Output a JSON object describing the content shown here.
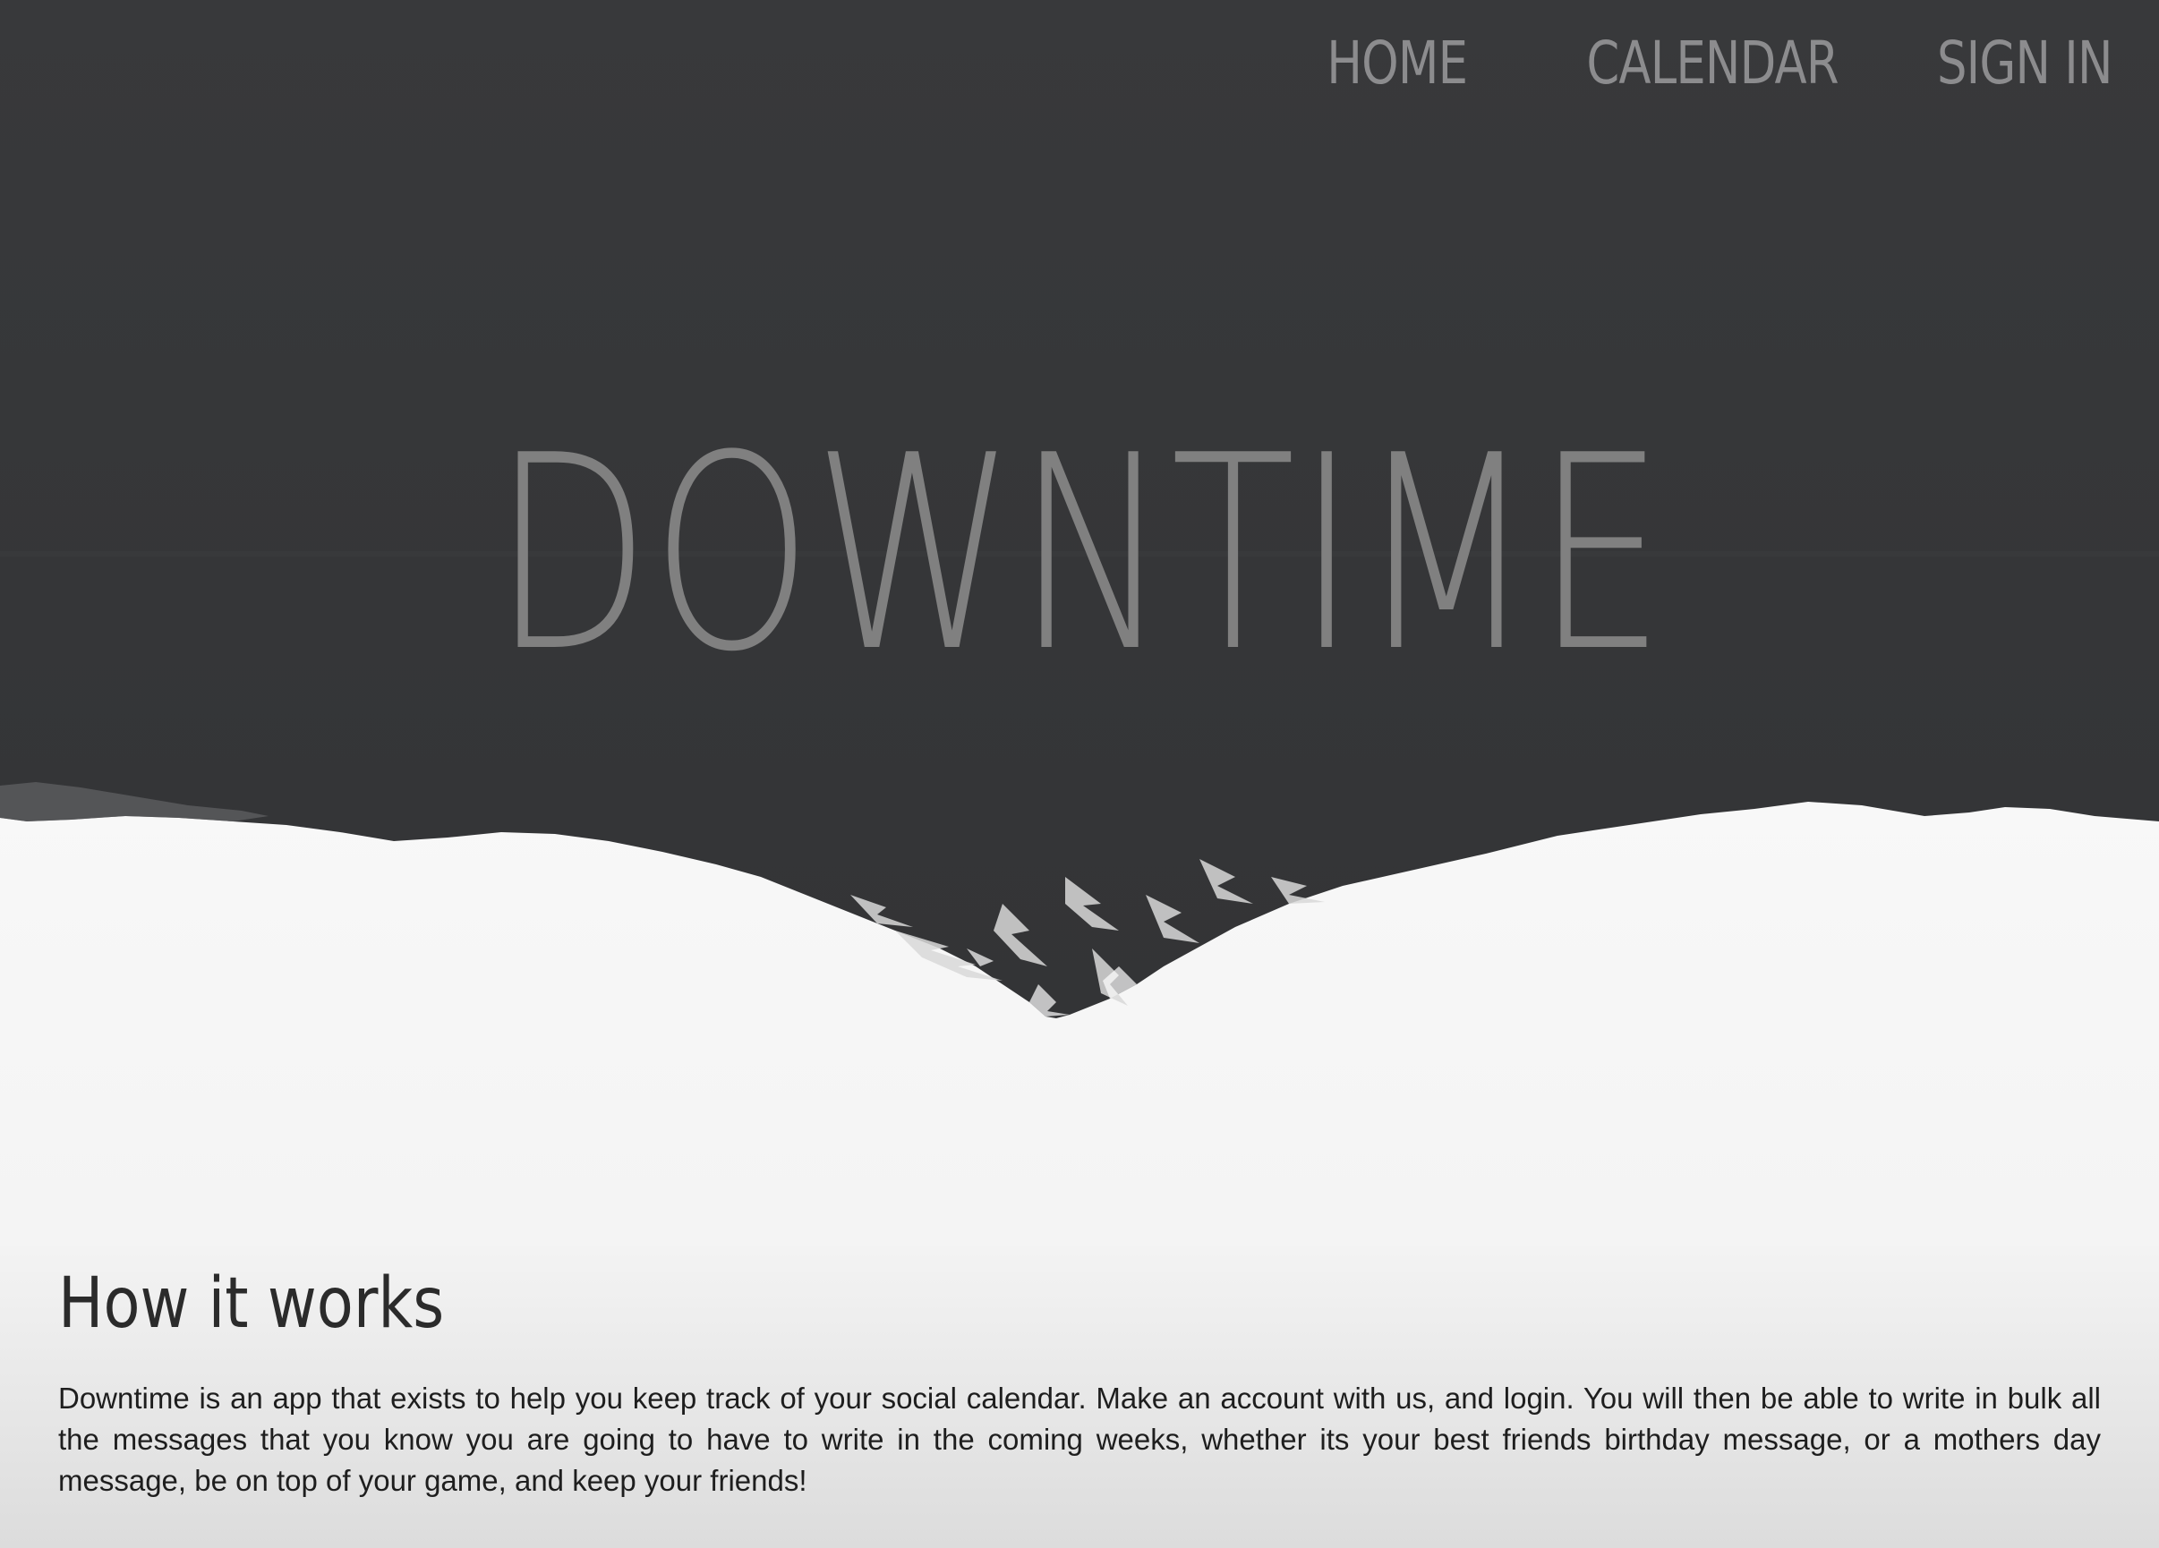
{
  "nav": {
    "items": [
      {
        "label": "HOME"
      },
      {
        "label": "CALENDAR"
      },
      {
        "label": "SIGN IN"
      }
    ]
  },
  "hero": {
    "title": "DOWNTIME"
  },
  "how_it_works": {
    "heading": "How it works",
    "body": "Downtime is an app that exists to help you keep track of your social calendar. Make an account with us, and login. You will then be able to write in bulk all the messages that you know you are going to have to write in the coming weeks, whether its your best friends birthday message, or a mothers day message, be on top of your game, and keep your friends!"
  },
  "colors": {
    "dark_sky": "#38393b",
    "snow": "#f6f6f6",
    "nav_text": "#8c8c8e",
    "title_text": "#808080",
    "body_text": "#1e1e1e"
  }
}
